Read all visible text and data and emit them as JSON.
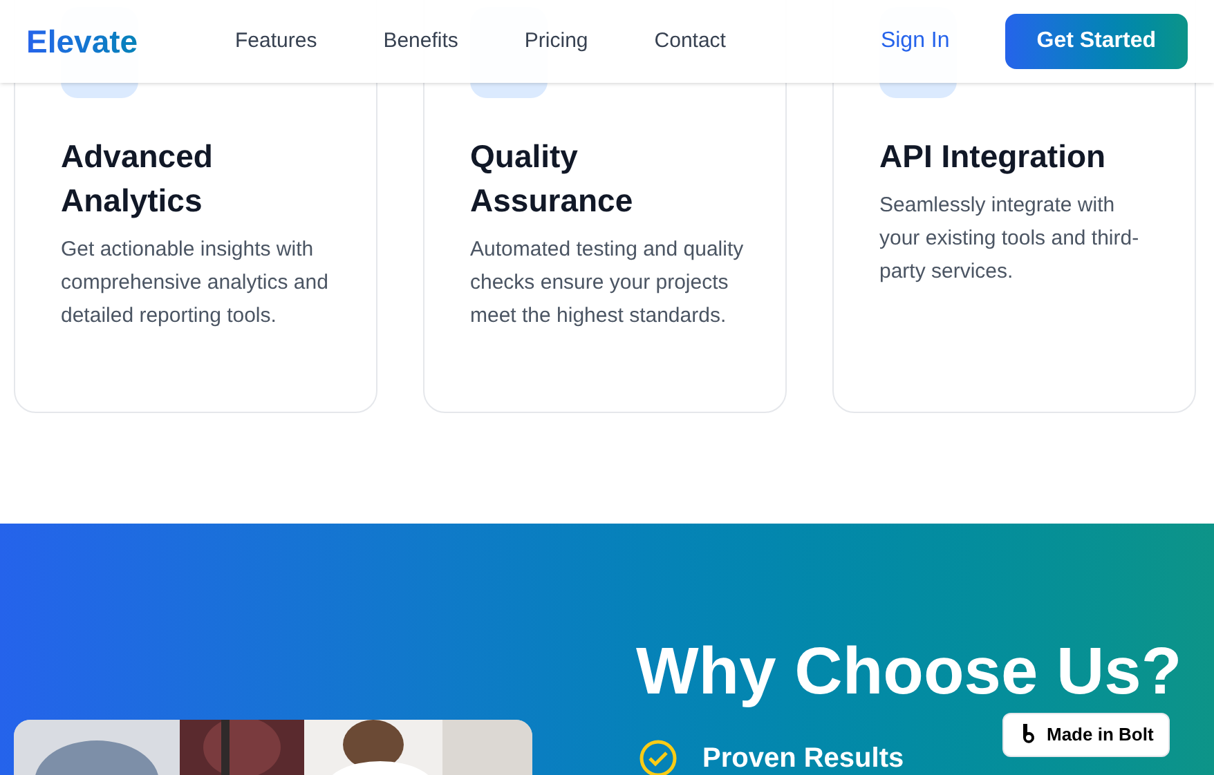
{
  "header": {
    "logo": "Elevate",
    "nav": [
      "Features",
      "Benefits",
      "Pricing",
      "Contact"
    ],
    "sign_in": "Sign In",
    "cta": "Get Started"
  },
  "features": [
    {
      "title": "Advanced Analytics",
      "description": "Get actionable insights with comprehensive analytics and detailed reporting tools."
    },
    {
      "title": "Quality Assurance",
      "description": "Automated testing and quality checks ensure your projects meet the highest standards."
    },
    {
      "title": "API Integration",
      "description": "Seamlessly integrate with your existing tools and third-party services."
    }
  ],
  "why": {
    "title": "Why Choose Us?",
    "items": [
      {
        "title": "Proven Results"
      }
    ]
  },
  "badge": {
    "label": "Made in Bolt"
  }
}
